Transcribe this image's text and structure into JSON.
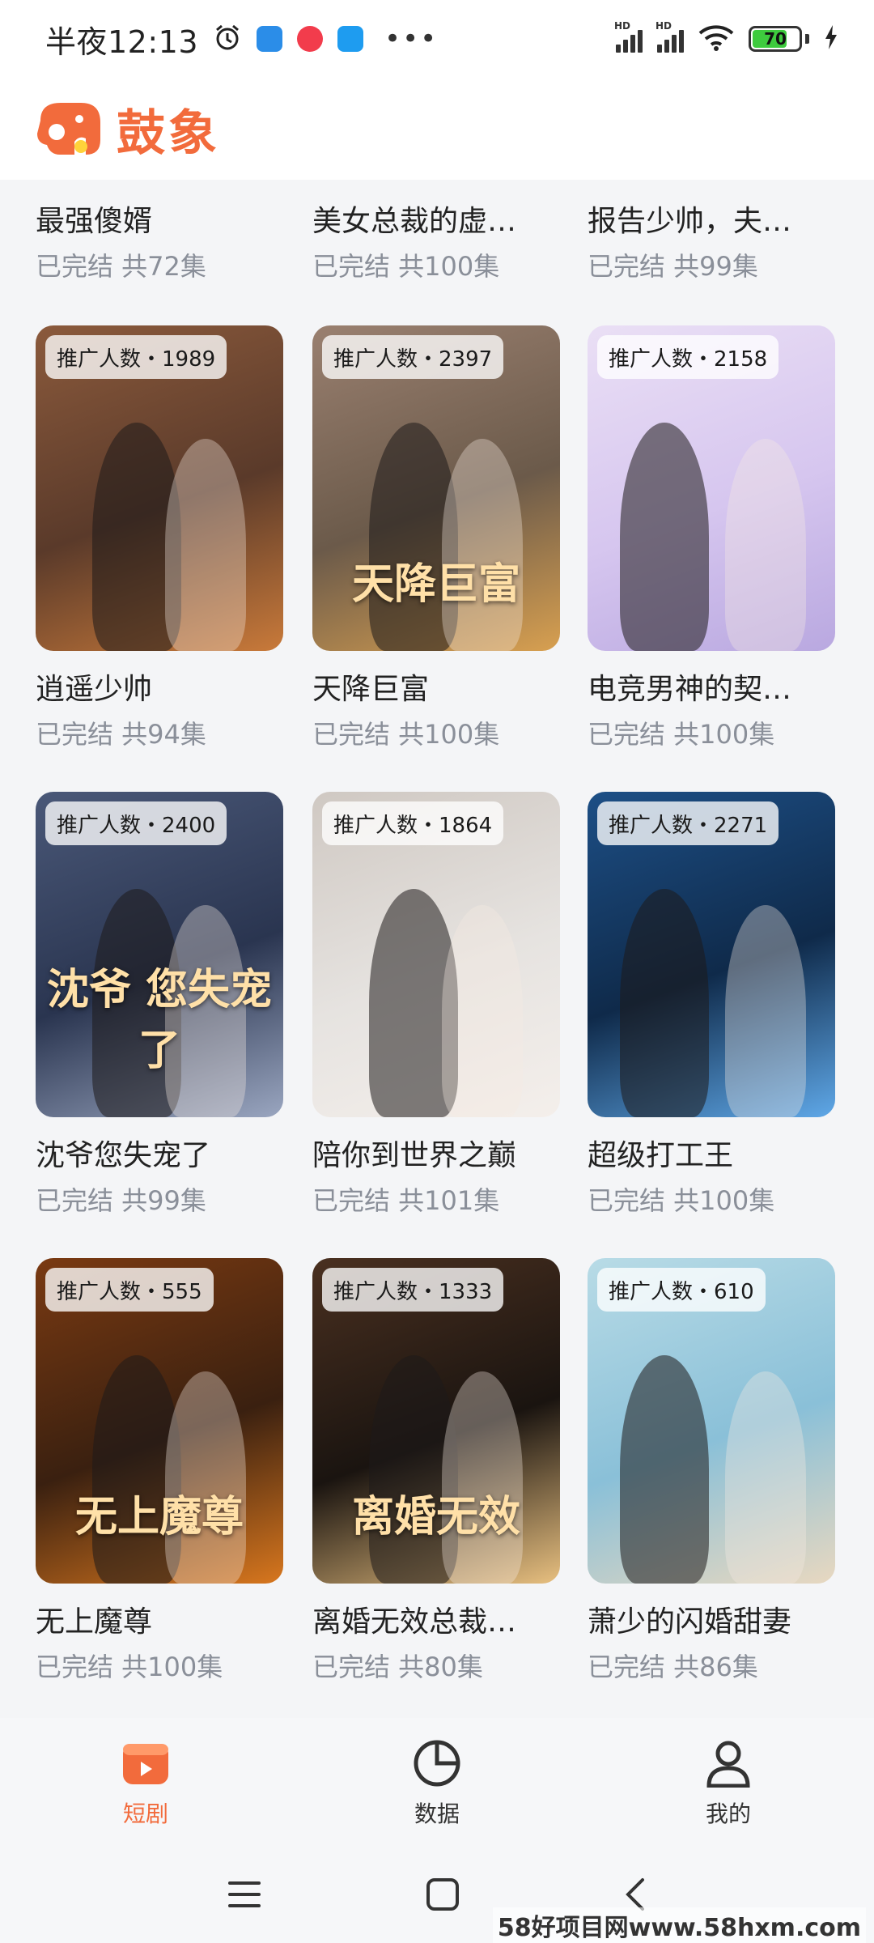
{
  "status_bar": {
    "time": "半夜12:13",
    "battery": "70",
    "icons": [
      "alarm-icon",
      "app-calendar-icon",
      "music-icon",
      "cloud-icon",
      "more-dots-icon",
      "hd-signal-icon",
      "hd-signal-icon",
      "wifi-icon",
      "battery-icon",
      "charging-icon"
    ],
    "dots": "•••",
    "hd": "HD"
  },
  "brand": {
    "name": "鼓象",
    "accent": "#f26b3c"
  },
  "top_row": [
    {
      "title": "最强傻婿",
      "meta": "已完结 共72集"
    },
    {
      "title": "美女总裁的虚…",
      "meta": "已完结 共100集"
    },
    {
      "title": "报告少帅，夫…",
      "meta": "已完结 共99集"
    }
  ],
  "grid": [
    [
      {
        "badge": "推广人数・1989",
        "title": "逍遥少帅",
        "meta": "已完结 共94集",
        "overlay": "",
        "colors": [
          "#5a3a2a",
          "#8b5a3c",
          "#c97a3a"
        ]
      },
      {
        "badge": "推广人数・2397",
        "title": "天降巨富",
        "meta": "已完结 共100集",
        "overlay": "天降巨富",
        "colors": [
          "#6b5a4a",
          "#9a8070",
          "#d8a050"
        ]
      },
      {
        "badge": "推广人数・2158",
        "title": "电竞男神的契…",
        "meta": "已完结 共100集",
        "overlay": "",
        "colors": [
          "#d6c6ef",
          "#eadff5",
          "#b9a8e0"
        ]
      }
    ],
    [
      {
        "badge": "推广人数・2400",
        "title": "沈爷您失宠了",
        "meta": "已完结 共99集",
        "overlay": "沈爷 您失宠了",
        "colors": [
          "#2a3550",
          "#4a5878",
          "#9aa6c0"
        ]
      },
      {
        "badge": "推广人数・1864",
        "title": "陪你到世界之巅",
        "meta": "已完结 共101集",
        "overlay": "",
        "colors": [
          "#e6e3e0",
          "#cfc8c2",
          "#f4efeb"
        ]
      },
      {
        "badge": "推广人数・2271",
        "title": "超级打工王",
        "meta": "已完结 共100集",
        "overlay": "",
        "colors": [
          "#0f2a4a",
          "#1d4f86",
          "#5fa8e8"
        ]
      }
    ],
    [
      {
        "badge": "推广人数・555",
        "title": "无上魔尊",
        "meta": "已完结 共100集",
        "overlay": "无上魔尊",
        "colors": [
          "#3a2010",
          "#7a3a12",
          "#d8771e"
        ]
      },
      {
        "badge": "推广人数・1333",
        "title": "离婚无效总裁…",
        "meta": "已完结 共80集",
        "overlay": "离婚无效",
        "colors": [
          "#1a1410",
          "#4a3020",
          "#e8c080"
        ]
      },
      {
        "badge": "推广人数・610",
        "title": "萧少的闪婚甜妻",
        "meta": "已完结 共86集",
        "overlay": "",
        "colors": [
          "#8ac0d8",
          "#b8dbe6",
          "#e8d8c0"
        ]
      }
    ]
  ],
  "bottom_nav": [
    {
      "label": "短剧",
      "icon": "short-drama-icon",
      "active": true
    },
    {
      "label": "数据",
      "icon": "pie-chart-icon",
      "active": false
    },
    {
      "label": "我的",
      "icon": "profile-icon",
      "active": false
    }
  ],
  "system_bar": [
    "menu-icon",
    "home-icon",
    "back-icon"
  ],
  "watermark": "58好项目网www.58hxm.com"
}
